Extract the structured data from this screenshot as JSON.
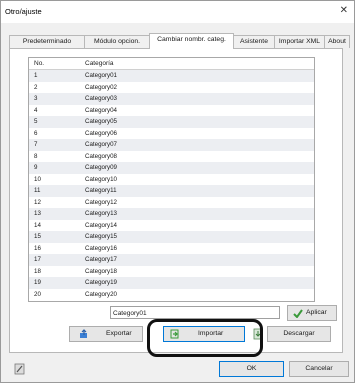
{
  "window": {
    "title": "Otro/ajuste",
    "close_glyph": "✕"
  },
  "tabs": [
    {
      "label": "Predeterminado"
    },
    {
      "label": "Módulo opcion."
    },
    {
      "label": "Cambiar nombr. categ."
    },
    {
      "label": "Asistente"
    },
    {
      "label": "Importar XML"
    },
    {
      "label": "About"
    }
  ],
  "active_tab": "Cambiar nombr. categ.",
  "list": {
    "columns": [
      "No.",
      "Categoría"
    ],
    "rows": [
      [
        "1",
        "Category01"
      ],
      [
        "2",
        "Category02"
      ],
      [
        "3",
        "Category03"
      ],
      [
        "4",
        "Category04"
      ],
      [
        "5",
        "Category05"
      ],
      [
        "6",
        "Category06"
      ],
      [
        "7",
        "Category07"
      ],
      [
        "8",
        "Category08"
      ],
      [
        "9",
        "Category09"
      ],
      [
        "10",
        "Category10"
      ],
      [
        "11",
        "Category11"
      ],
      [
        "12",
        "Category12"
      ],
      [
        "13",
        "Category13"
      ],
      [
        "14",
        "Category14"
      ],
      [
        "15",
        "Category15"
      ],
      [
        "16",
        "Category16"
      ],
      [
        "17",
        "Category17"
      ],
      [
        "18",
        "Category18"
      ],
      [
        "19",
        "Category19"
      ],
      [
        "20",
        "Category20"
      ]
    ]
  },
  "edit": {
    "value": "Category01"
  },
  "buttons": {
    "aplicar": "Aplicar",
    "exportar": "Exportar",
    "importar": "Importar",
    "descargar": "Descargar",
    "ok": "OK",
    "cancelar": "Cancelar"
  },
  "colors": {
    "focus_border": "#0078d7",
    "check_green": "#3a9a3a",
    "alt_row": "#eceef2"
  },
  "icons": {
    "aplicar": "checkmark-icon",
    "exportar": "export-icon",
    "importar": "import-icon",
    "descargar": "download-icon",
    "bottom_left": "notebook-icon"
  }
}
